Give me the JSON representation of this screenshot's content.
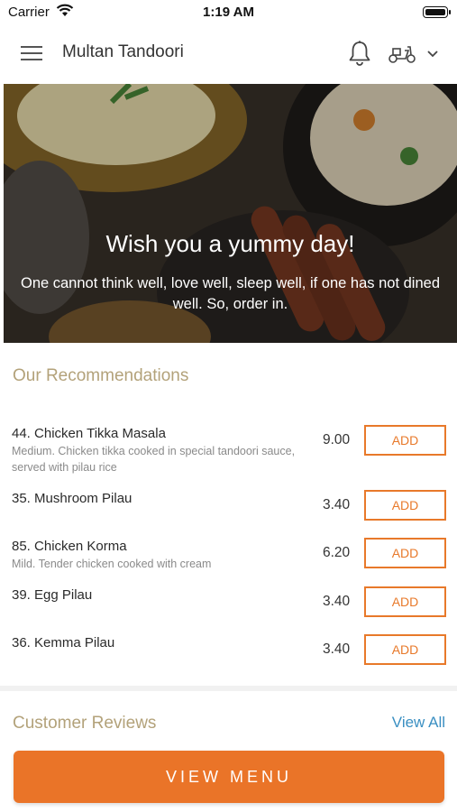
{
  "status_bar": {
    "carrier": "Carrier",
    "time": "1:19 AM"
  },
  "header": {
    "title": "Multan Tandoori",
    "icons": [
      "hamburger-menu-icon",
      "bell-icon",
      "scooter-icon",
      "chevron-down-icon"
    ]
  },
  "hero": {
    "headline": "Wish you a yummy day!",
    "tagline": "One cannot think well, love well, sleep well, if one has not dined well. So, order in."
  },
  "recommendations": {
    "title": "Our Recommendations",
    "items": [
      {
        "name": "44. Chicken Tikka Masala",
        "description": "Medium. Chicken tikka cooked in special tandoori sauce, served with pilau rice",
        "price": "9.00",
        "button": "ADD"
      },
      {
        "name": "35. Mushroom Pilau",
        "description": "",
        "price": "3.40",
        "button": "ADD"
      },
      {
        "name": "85. Chicken Korma",
        "description": "Mild. Tender chicken cooked with cream",
        "price": "6.20",
        "button": "ADD"
      },
      {
        "name": "39. Egg Pilau",
        "description": "",
        "price": "3.40",
        "button": "ADD"
      },
      {
        "name": "36. Kemma Pilau",
        "description": "",
        "price": "3.40",
        "button": "ADD"
      }
    ]
  },
  "reviews": {
    "title": "Customer Reviews",
    "view_all": "View All"
  },
  "footer": {
    "view_menu": "VIEW MENU"
  },
  "colors": {
    "accent": "#ea7428",
    "section_title": "#b3a27a",
    "link": "#3a8fc2"
  }
}
